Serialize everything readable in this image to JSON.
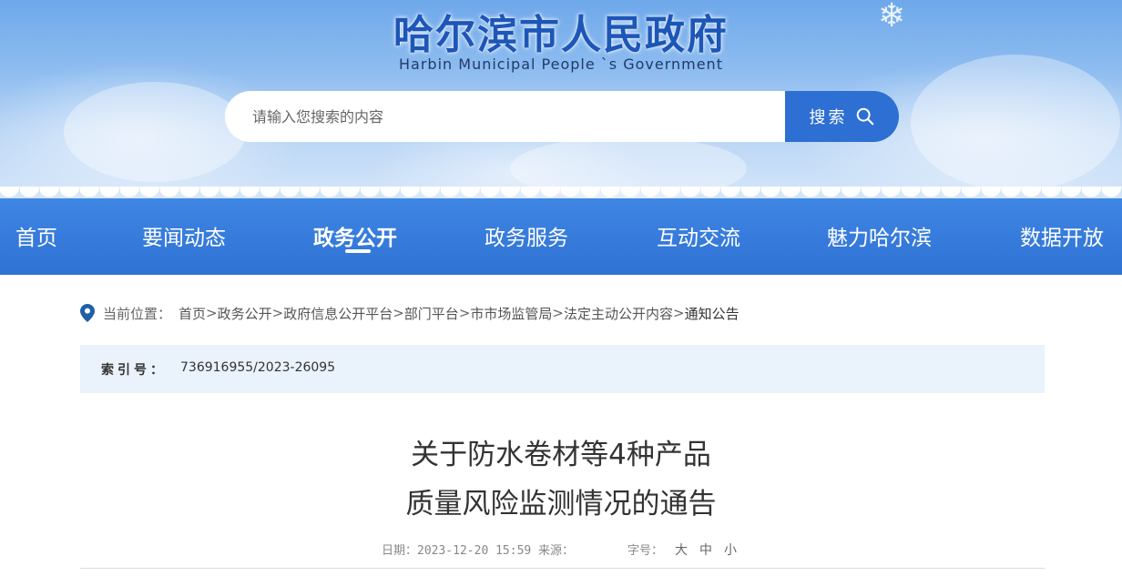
{
  "header": {
    "title": "哈尔滨市人民政府",
    "subtitle": "Harbin Municipal People `s Government",
    "search": {
      "placeholder": "请输入您搜索的内容",
      "button_label": "搜索",
      "icon": "search-icon"
    }
  },
  "nav": {
    "items": [
      {
        "label": "首页"
      },
      {
        "label": "要闻动态"
      },
      {
        "label": "政务公开",
        "active": true
      },
      {
        "label": "政务服务"
      },
      {
        "label": "互动交流"
      },
      {
        "label": "魅力哈尔滨"
      },
      {
        "label": "数据开放"
      }
    ]
  },
  "breadcrumb": {
    "label": "当前位置：",
    "icon": "location-pin-icon",
    "items": [
      "首页",
      "政务公开",
      "政府信息公开平台",
      "部门平台",
      "市市场监管局",
      "法定主动公开内容",
      "通知公告"
    ],
    "separator": ">"
  },
  "info": {
    "index_label": "索引号：",
    "index_value": "736916955/2023-26095"
  },
  "article": {
    "title_line1": "关于防水卷材等4种产品",
    "title_line2": "质量风险监测情况的通告",
    "date_text": "日期：2023-12-20 15:59 来源：",
    "font_size_label": "字号：",
    "font_sizes": [
      "大",
      "中",
      "小"
    ]
  },
  "colors": {
    "nav_bg": "#2f72d4",
    "search_button": "#2d6fd2",
    "title_blue": "#1d56b8",
    "info_bg": "#eaf2fb"
  }
}
